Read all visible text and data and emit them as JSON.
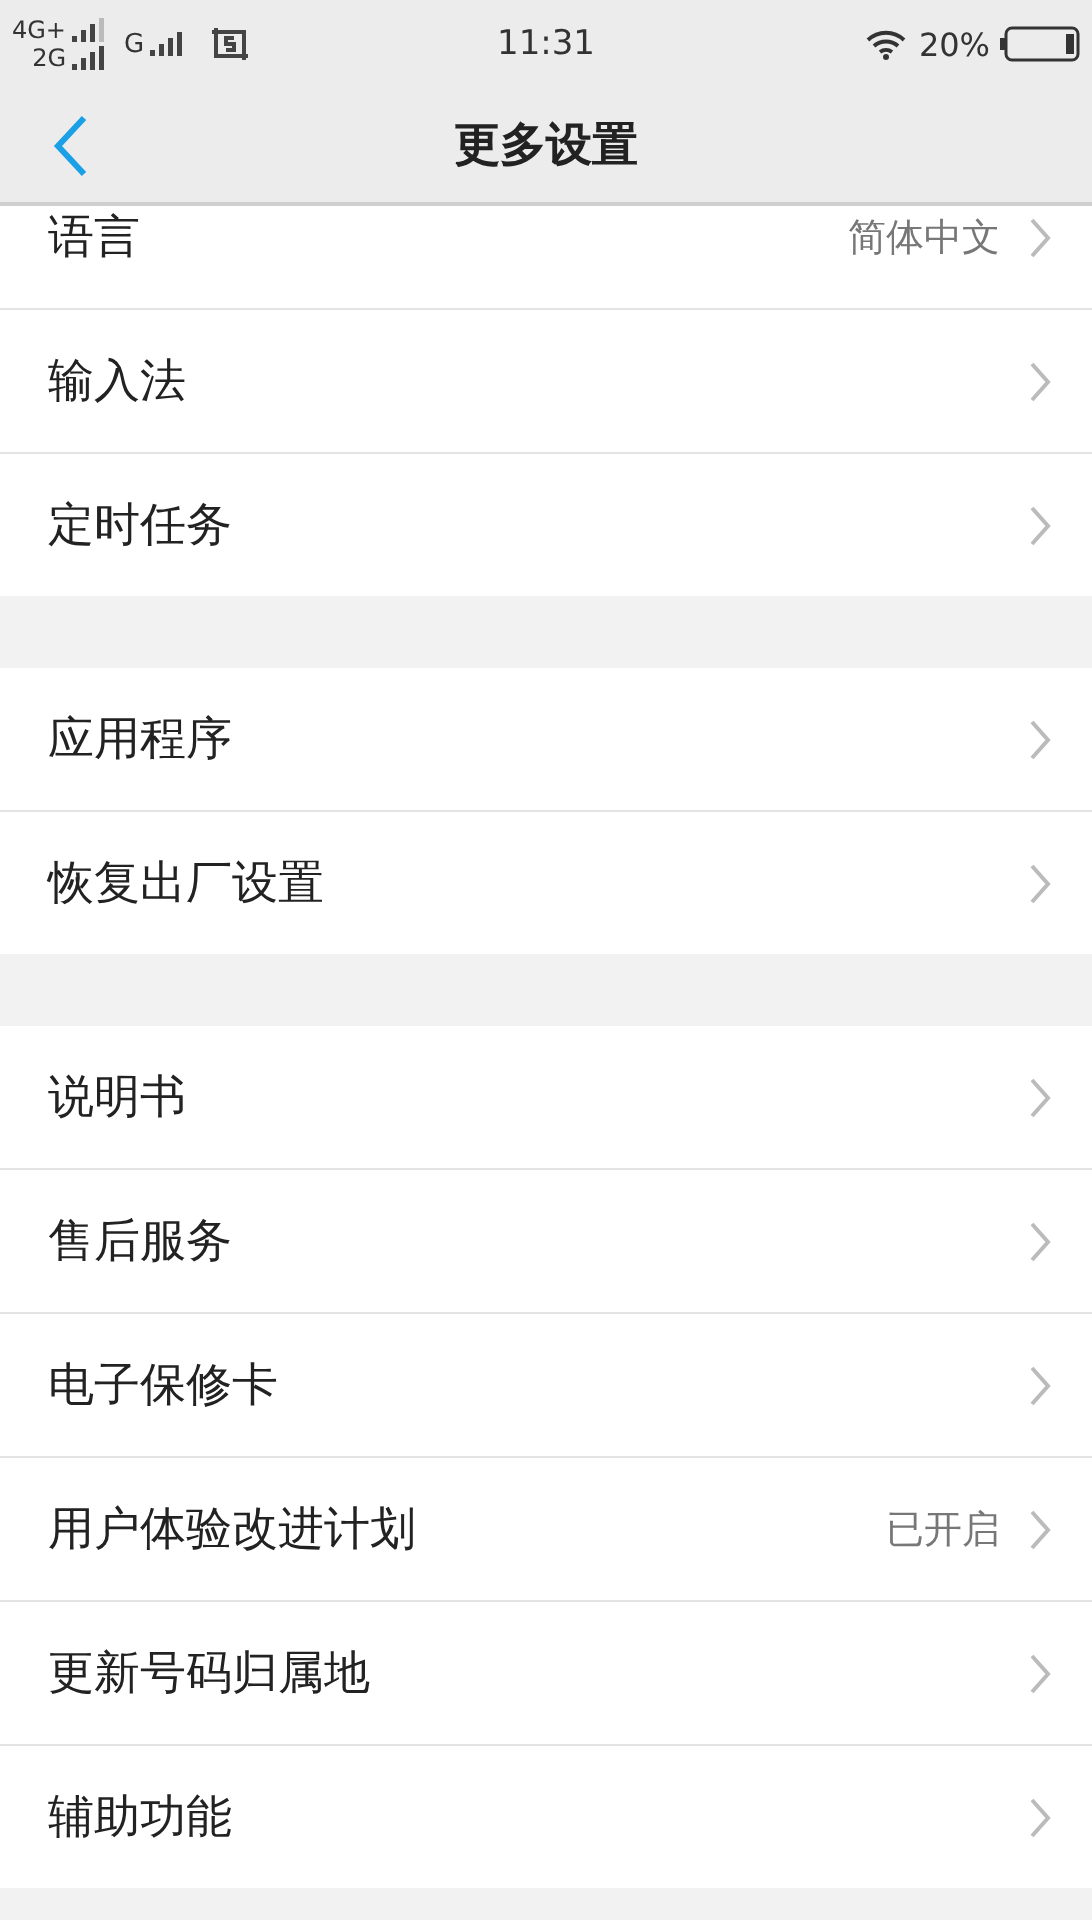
{
  "status_bar": {
    "network_1": "4G+",
    "network_2": "2G",
    "network_3": "G",
    "time": "11:31",
    "battery": "20%"
  },
  "header": {
    "title": "更多设置"
  },
  "groups": [
    {
      "items": [
        {
          "label": "语言",
          "value": "简体中文"
        },
        {
          "label": "输入法"
        },
        {
          "label": "定时任务"
        }
      ]
    },
    {
      "items": [
        {
          "label": "应用程序"
        },
        {
          "label": "恢复出厂设置"
        }
      ]
    },
    {
      "items": [
        {
          "label": "说明书"
        },
        {
          "label": "售后服务"
        },
        {
          "label": "电子保修卡"
        },
        {
          "label": "用户体验改进计划",
          "value": "已开启"
        },
        {
          "label": "更新号码归属地"
        },
        {
          "label": "辅助功能"
        }
      ]
    }
  ]
}
